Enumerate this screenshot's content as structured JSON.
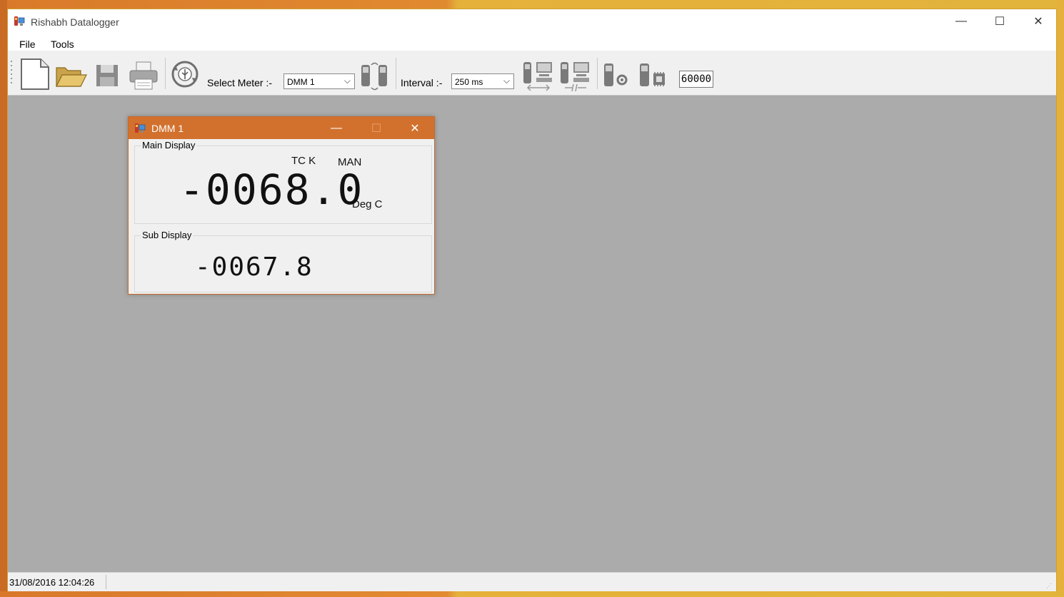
{
  "app": {
    "title": "Rishabh Datalogger",
    "window_controls": {
      "minimize": "—",
      "maximize": "☐",
      "close": "✕"
    }
  },
  "menu": [
    "File",
    "Tools"
  ],
  "toolbar": {
    "select_meter_label": "Select Meter :-",
    "select_meter_value": "DMM 1",
    "interval_label": "Interval :-",
    "interval_value": "250 ms",
    "sample_count": "60000",
    "icons": [
      "new-file-icon",
      "open-folder-icon",
      "save-icon",
      "print-icon",
      "usb-connect-icon",
      "meter-swap-icon",
      "meter-pc-transfer-icon",
      "meter-pc-disconnect-icon",
      "meter-settings-icon",
      "meter-memory-icon"
    ]
  },
  "child_window": {
    "title": "DMM 1",
    "controls": {
      "minimize": "—",
      "maximize": "☐",
      "close": "✕"
    },
    "main_display": {
      "legend": "Main Display",
      "mode": "TC K",
      "range": "MAN",
      "value": "-0068.0",
      "unit": "Deg C"
    },
    "sub_display": {
      "legend": "Sub Display",
      "value": "-0067.8"
    }
  },
  "status": {
    "datetime": "31/08/2016 12:04:26"
  },
  "colors": {
    "child_titlebar": "#d2712d",
    "mdi_background": "#ababab",
    "desktop_accent": "#e5b13a"
  }
}
